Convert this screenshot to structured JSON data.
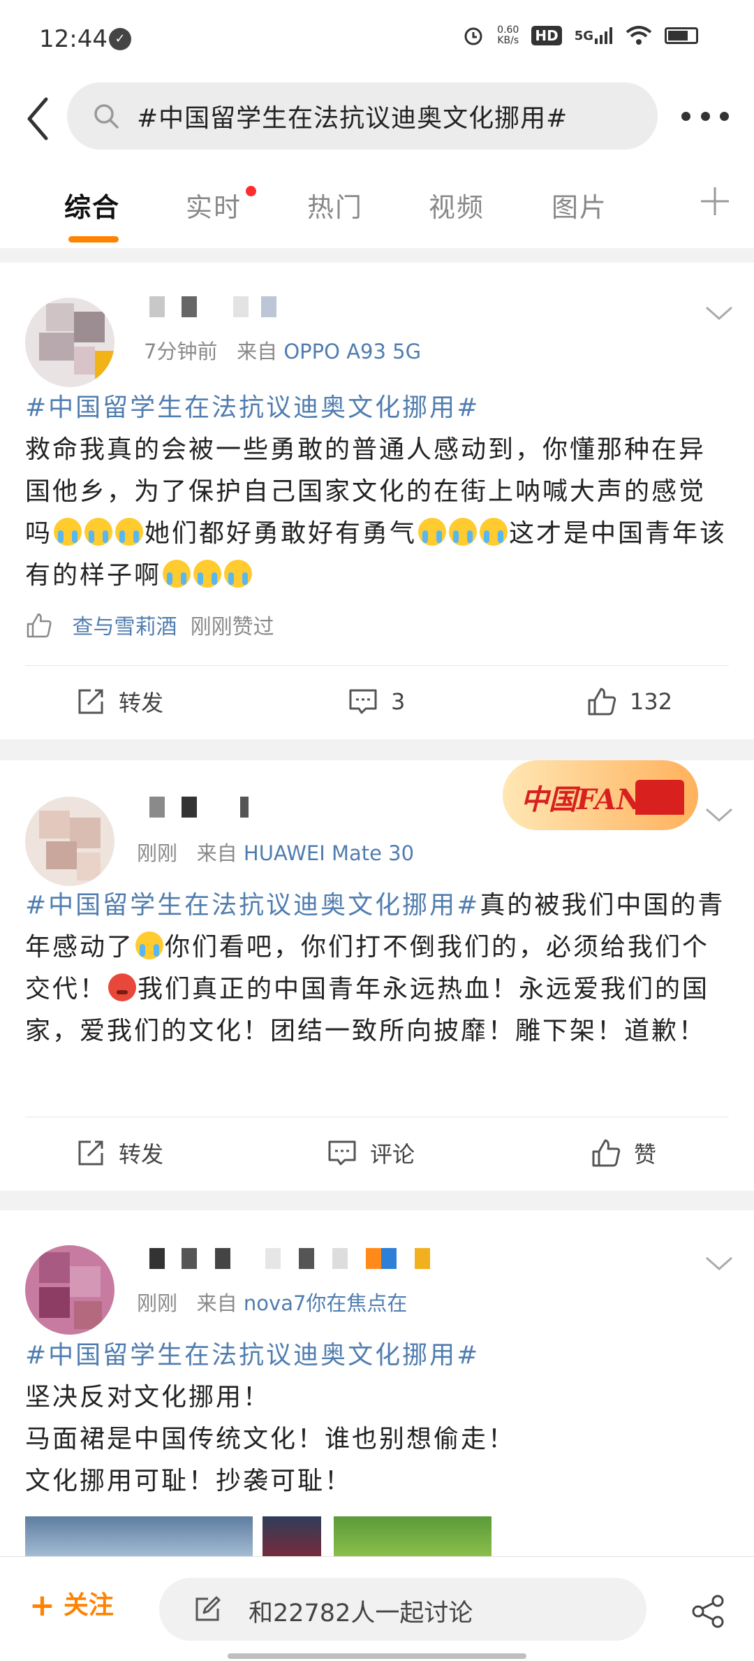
{
  "status_bar": {
    "time": "12:44",
    "speed_value": "0.60",
    "speed_unit": "KB/s",
    "hd": "HD",
    "network": "5G"
  },
  "search": {
    "query": "#中国留学生在法抗议迪奥文化挪用#"
  },
  "tabs": [
    {
      "label": "综合",
      "active": true
    },
    {
      "label": "实时",
      "active": false,
      "has_dot": true
    },
    {
      "label": "热门",
      "active": false
    },
    {
      "label": "视频",
      "active": false
    },
    {
      "label": "图片",
      "active": false
    }
  ],
  "posts": [
    {
      "meta_time": "7分钟前",
      "meta_from": "来自",
      "device": "OPPO A93 5G",
      "hashtag": "#中国留学生在法抗议迪奥文化挪用#",
      "text_1": "救命我真的会被一些勇敢的普通人感动到，你懂那种在异国他乡，为了保护自己国家文化的在街上呐喊大声的感觉吗",
      "text_2": "她们都好勇敢好有勇气",
      "text_3": "这才是中国青年该有的样子啊",
      "liked_by": "查与雪莉酒",
      "liked_note": "刚刚赞过",
      "repost_label": "转发",
      "comment_count": "3",
      "like_count": "132"
    },
    {
      "meta_time": "刚刚",
      "meta_from": "来自",
      "device": "HUAWEI Mate 30",
      "badge": "中国FANS",
      "hashtag": "#中国留学生在法抗议迪奥文化挪用#",
      "text_1": "真的被我们中国的青年感动了",
      "text_2": "你们看吧，你们打不倒我们的，必须给我们个交代！",
      "text_3": "我们真正的中国青年永远热血！永远爱我们的国家，爱我们的文化！团结一致所向披靡！雕下架！道歉！",
      "repost_label": "转发",
      "comment_label": "评论",
      "like_label": "赞"
    },
    {
      "meta_time": "刚刚",
      "meta_from": "来自",
      "device": "nova7你在焦点在",
      "hashtag": "#中国留学生在法抗议迪奥文化挪用#",
      "line_1": "坚决反对文化挪用！",
      "line_2": "马面裙是中国传统文化！谁也别想偷走！",
      "line_3": "文化挪用可耻！抄袭可耻！"
    }
  ],
  "bottom_bar": {
    "follow_plus": "+",
    "follow_label": "关注",
    "discuss_label": "和22782人一起讨论"
  },
  "colors": {
    "accent": "#ff8200",
    "link": "#507daf",
    "badge_red": "#d8201f"
  }
}
